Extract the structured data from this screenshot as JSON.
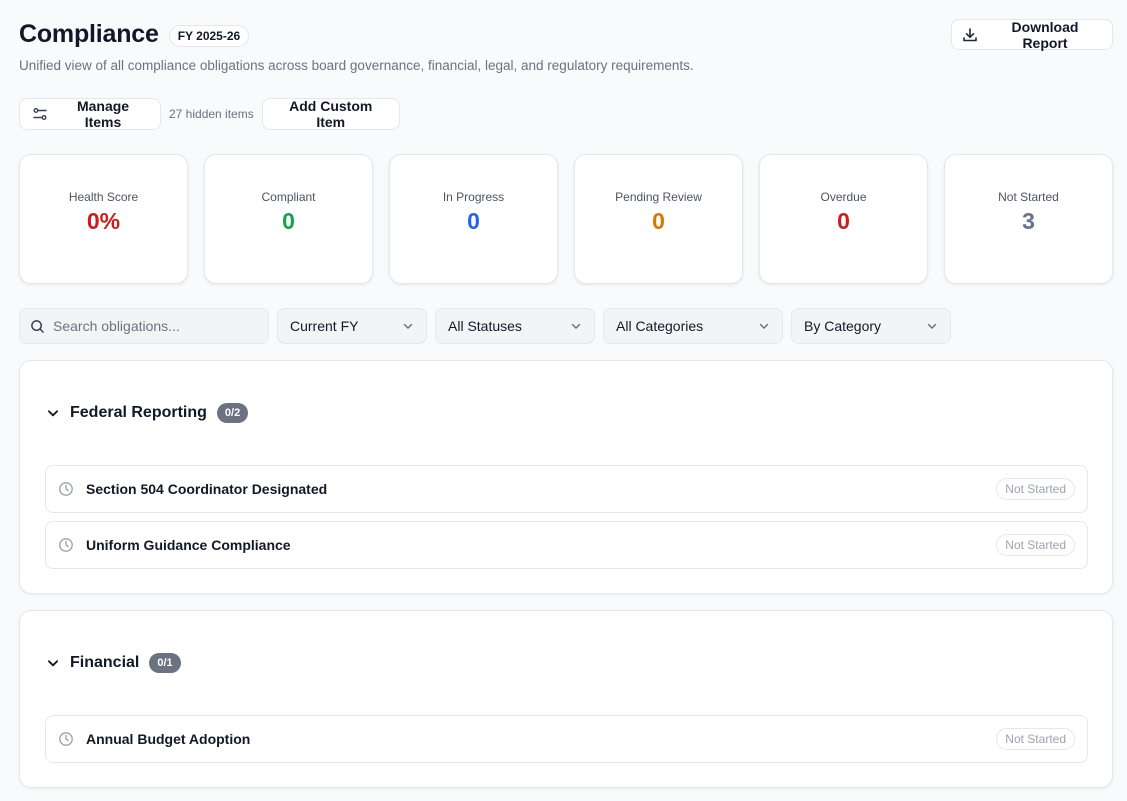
{
  "header": {
    "title": "Compliance",
    "fy_badge": "FY 2025-26",
    "subtitle": "Unified view of all compliance obligations across board governance, financial, legal, and regulatory requirements.",
    "download_label": "Download Report"
  },
  "toolbar": {
    "manage_label": "Manage Items",
    "hidden_count": "27 hidden items",
    "add_label": "Add Custom Item"
  },
  "stats": [
    {
      "label": "Health Score",
      "value": "0%",
      "color": "#c81e1e"
    },
    {
      "label": "Compliant",
      "value": "0",
      "color": "#16a34a"
    },
    {
      "label": "In Progress",
      "value": "0",
      "color": "#2563eb"
    },
    {
      "label": "Pending Review",
      "value": "0",
      "color": "#d97706"
    },
    {
      "label": "Overdue",
      "value": "0",
      "color": "#c81e1e"
    },
    {
      "label": "Not Started",
      "value": "3",
      "color": "#64748b"
    }
  ],
  "filters": {
    "search_placeholder": "Search obligations...",
    "fiscal_year": "Current FY",
    "status": "All Statuses",
    "category": "All Categories",
    "group_by": "By Category"
  },
  "sections": [
    {
      "title": "Federal Reporting",
      "count": "0/2",
      "items": [
        {
          "title": "Section 504 Coordinator Designated",
          "status": "Not Started",
          "icon": "clock-icon"
        },
        {
          "title": "Uniform Guidance Compliance",
          "status": "Not Started",
          "icon": "clock-icon"
        }
      ]
    },
    {
      "title": "Financial",
      "count": "0/1",
      "items": [
        {
          "title": "Annual Budget Adoption",
          "status": "Not Started",
          "icon": "clock-icon"
        }
      ]
    }
  ]
}
